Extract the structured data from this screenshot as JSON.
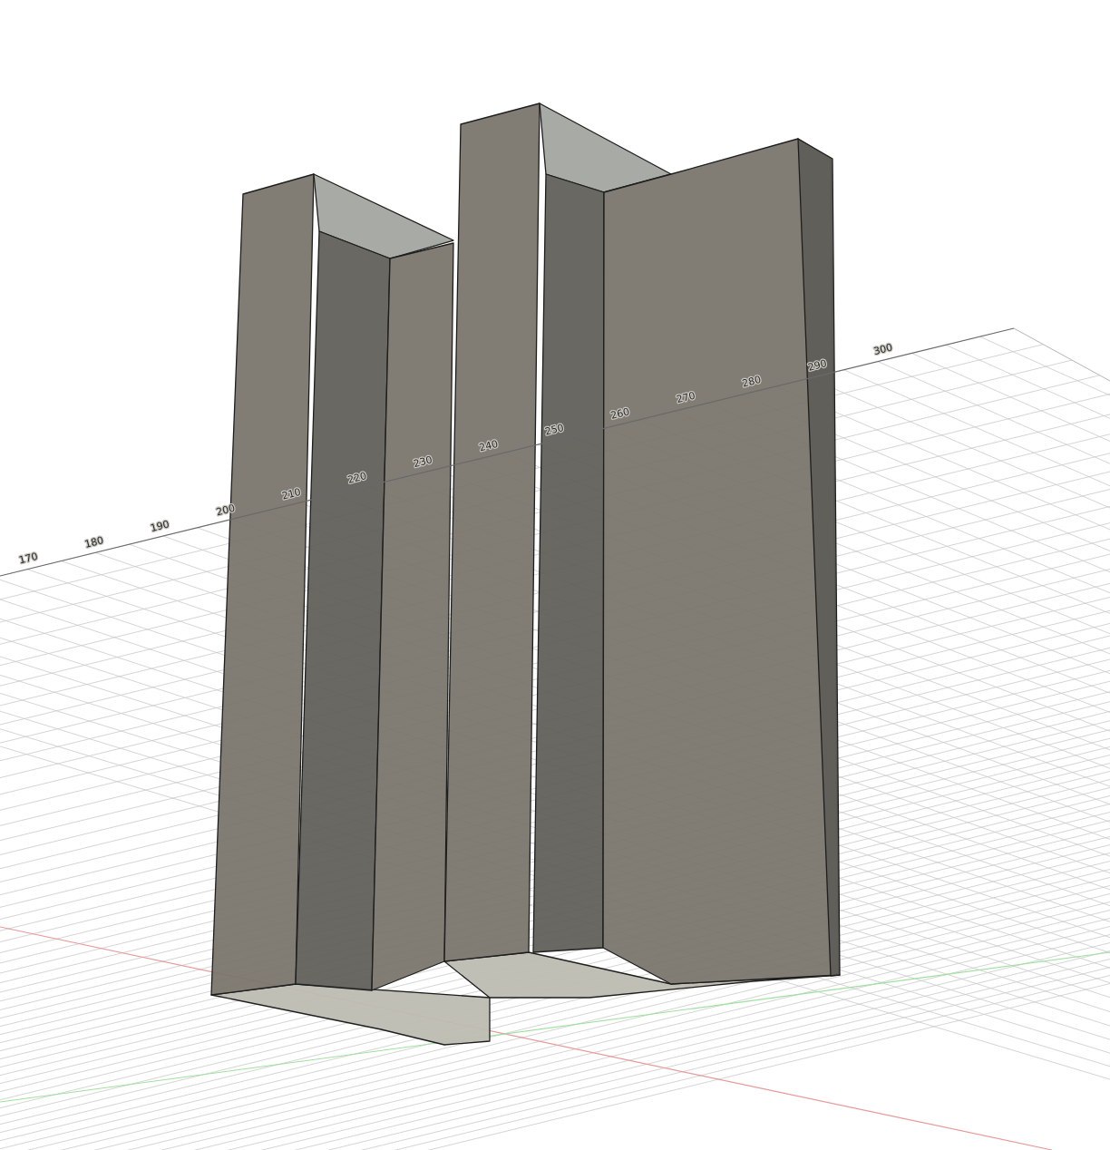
{
  "viewport": {
    "axis_labels": [
      "170",
      "180",
      "190",
      "200",
      "210",
      "220",
      "230",
      "240",
      "250",
      "260",
      "270",
      "280",
      "290",
      "300"
    ]
  }
}
